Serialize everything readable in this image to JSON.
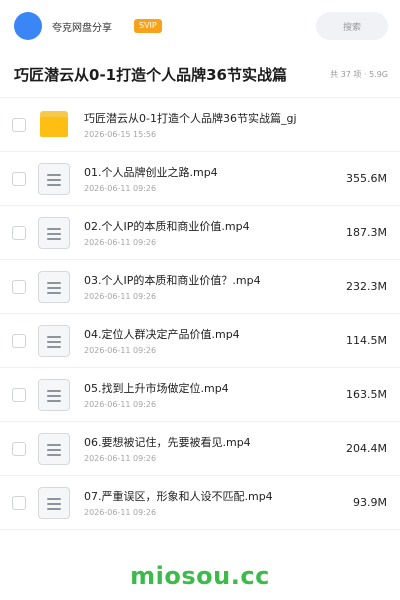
{
  "header": {
    "app_name": "夸克网盘分享",
    "badge": "SVIP",
    "search_placeholder": "搜索",
    "brand_color": "#3a86f7",
    "badge_color": "#f7a21b"
  },
  "title_bar": {
    "title": "巧匠潜云从0-1打造个人品牌36节实战篇",
    "meta": "共 37 项 · 5.9G"
  },
  "files": [
    {
      "name": "巧匠潜云从0-1打造个人品牌36节实战篇_gj",
      "date": "2026-06-15 15:56",
      "size": "",
      "icon": "folder-icon"
    },
    {
      "name": "01.个人品牌创业之路.mp4",
      "date": "2026-06-11 09:26",
      "size": "355.6M",
      "icon": "video-file-icon"
    },
    {
      "name": "02.个人IP的本质和商业价值.mp4",
      "date": "2026-06-11 09:26",
      "size": "187.3M",
      "icon": "video-file-icon"
    },
    {
      "name": "03.个人IP的本质和商业价值？.mp4",
      "date": "2026-06-11 09:26",
      "size": "232.3M",
      "icon": "video-file-icon"
    },
    {
      "name": "04.定位人群决定产品价值.mp4",
      "date": "2026-06-11 09:26",
      "size": "114.5M",
      "icon": "video-file-icon"
    },
    {
      "name": "05.找到上升市场做定位.mp4",
      "date": "2026-06-11 09:26",
      "size": "163.5M",
      "icon": "video-file-icon"
    },
    {
      "name": "06.要想被记住，先要被看见.mp4",
      "date": "2026-06-11 09:26",
      "size": "204.4M",
      "icon": "video-file-icon"
    },
    {
      "name": "07.严重误区，形象和人设不匹配.mp4",
      "date": "2026-06-11 09:26",
      "size": "93.9M",
      "icon": "video-file-icon"
    }
  ],
  "watermark": "miosou.cc"
}
